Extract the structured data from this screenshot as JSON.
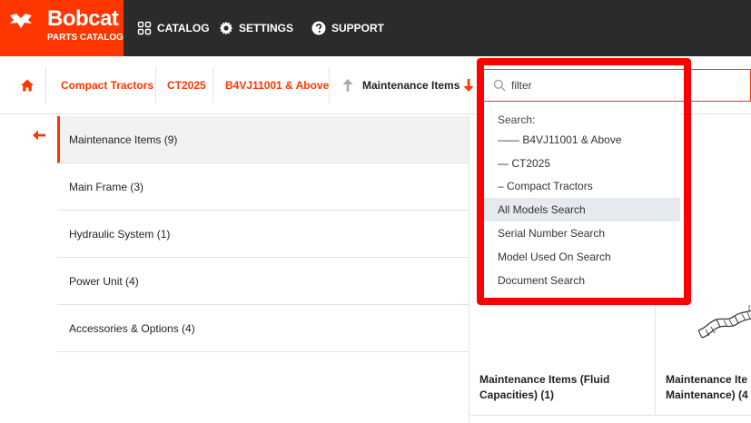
{
  "brand": {
    "name": "Bobcat",
    "sub": "PARTS CATALOG",
    "color": "#ff3600"
  },
  "nav": {
    "catalog": "CATALOG",
    "settings": "SETTINGS",
    "support": "SUPPORT"
  },
  "breadcrumb": {
    "items": [
      "Compact Tractors",
      "CT2025",
      "B4VJ11001 & Above"
    ],
    "current": "Maintenance Items"
  },
  "sidebar": {
    "items": [
      {
        "label": "Maintenance Items (9)",
        "active": true
      },
      {
        "label": "Main Frame (3)"
      },
      {
        "label": "Hydraulic System (1)"
      },
      {
        "label": "Power Unit (4)"
      },
      {
        "label": "Accessories & Options (4)"
      }
    ]
  },
  "search": {
    "placeholder": "filter",
    "value": "",
    "heading": "Search:",
    "options": [
      "—— B4VJ11001 & Above",
      "— CT2025",
      "– Compact Tractors",
      "All Models Search",
      "Serial Number Search",
      "Model Used On Search",
      "Document Search"
    ],
    "highlighted_option": "All Models Search"
  },
  "tiles": [
    {
      "line1": "Maintenance Items (Fluid",
      "line2": "Capacities) (1)"
    },
    {
      "line1": "Maintenance Ite",
      "line2": "Maintenance) (4"
    }
  ]
}
